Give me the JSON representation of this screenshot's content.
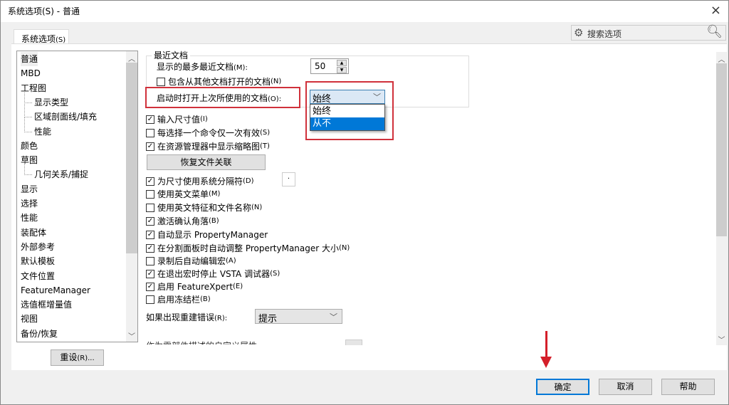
{
  "window": {
    "title": "系统选项(S) - 普通",
    "close_icon": "×"
  },
  "tab": {
    "label": "系统选项",
    "accel": "(S)"
  },
  "search": {
    "placeholder": "搜索选项"
  },
  "tree": {
    "items": [
      {
        "label": "普通",
        "level": 0,
        "selected": true
      },
      {
        "label": "MBD",
        "level": 0
      },
      {
        "label": "工程图",
        "level": 0
      },
      {
        "label": "显示类型",
        "level": 1
      },
      {
        "label": "区域剖面线/填充",
        "level": 1
      },
      {
        "label": "性能",
        "level": 1
      },
      {
        "label": "颜色",
        "level": 0
      },
      {
        "label": "草图",
        "level": 0
      },
      {
        "label": "几何关系/捕捉",
        "level": 1
      },
      {
        "label": "显示",
        "level": 0
      },
      {
        "label": "选择",
        "level": 0
      },
      {
        "label": "性能",
        "level": 0
      },
      {
        "label": "装配体",
        "level": 0
      },
      {
        "label": "外部参考",
        "level": 0
      },
      {
        "label": "默认模板",
        "level": 0
      },
      {
        "label": "文件位置",
        "level": 0
      },
      {
        "label": "FeatureManager",
        "level": 0
      },
      {
        "label": "选值框增量值",
        "level": 0
      },
      {
        "label": "视图",
        "level": 0
      },
      {
        "label": "备份/恢复",
        "level": 0
      }
    ]
  },
  "reset_button": {
    "label": "重设",
    "accel": "(R)..."
  },
  "recent_docs": {
    "group_label": "最近文档",
    "max_recent_label": "显示的最多最近文档",
    "max_recent_accel": "(M):",
    "max_recent_value": "50",
    "include_other": {
      "label": "包含从其他文档打开的文档",
      "accel": "(N)",
      "checked": false
    },
    "open_last_label": "启动时打开上次所使用的文档",
    "open_last_accel": "(O):",
    "open_last_value": "始终",
    "open_last_options": [
      "始终",
      "从不"
    ],
    "highlighted_option": "从不"
  },
  "options": [
    {
      "label": "输入尺寸值",
      "accel": "(I)",
      "checked": true
    },
    {
      "label": "每选择一个命令仅一次有效",
      "accel": "(S)",
      "checked": false
    },
    {
      "label": "在资源管理器中显示缩略图",
      "accel": "(T)",
      "checked": true
    }
  ],
  "restore_assoc_button": "恢复文件关联",
  "options2": [
    {
      "label": "为尺寸使用系统分隔符",
      "accel": "(D)",
      "checked": true
    },
    {
      "label": "使用英文菜单",
      "accel": "(M)",
      "checked": false
    },
    {
      "label": "使用英文特征和文件名称",
      "accel": "(N)",
      "checked": false
    },
    {
      "label": "激活确认角落",
      "accel": "(B)",
      "checked": true
    },
    {
      "label": "自动显示 PropertyManager",
      "accel": "",
      "checked": true
    },
    {
      "label": "在分割面板时自动调整 PropertyManager 大小",
      "accel": "(N)",
      "checked": true
    },
    {
      "label": "录制后自动编辑宏",
      "accel": "(A)",
      "checked": false
    },
    {
      "label": "在退出宏时停止 VSTA 调试器",
      "accel": "(S)",
      "checked": true
    },
    {
      "label": "启用 FeatureXpert",
      "accel": "(E)",
      "checked": true
    },
    {
      "label": "启用冻结栏",
      "accel": "(B)",
      "checked": false
    }
  ],
  "separator_value": ".",
  "rebuild_error": {
    "label": "如果出现重建错误",
    "accel": "(R):",
    "value": "提示"
  },
  "clipped_row": "作为零部件描述的自定义属性",
  "footer": {
    "ok": "确定",
    "cancel": "取消",
    "help": "帮助"
  },
  "accent_colors": {
    "highlight": "#d0313b",
    "selection": "#0078d7"
  }
}
